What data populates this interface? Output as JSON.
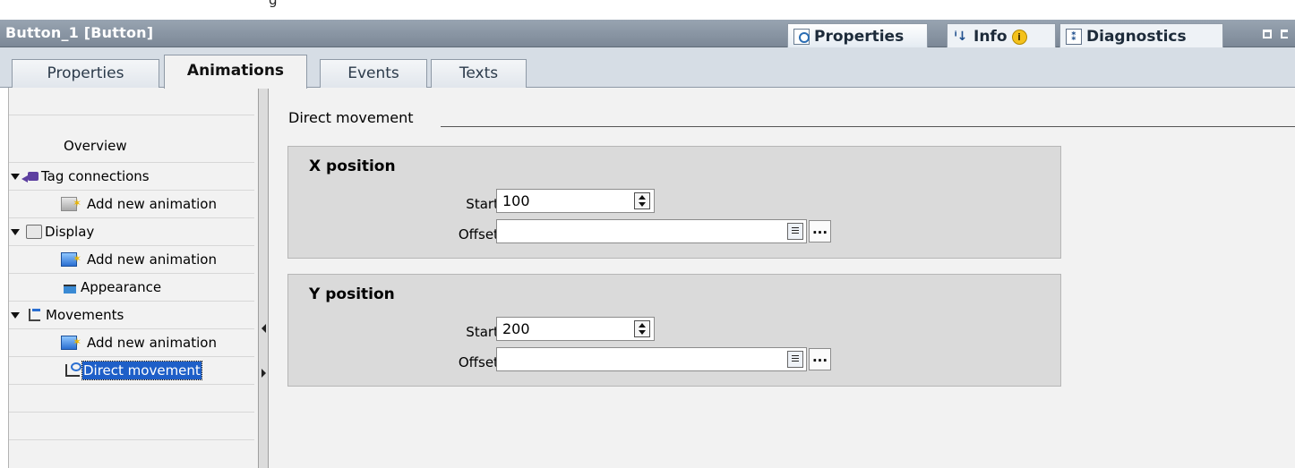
{
  "top_strip": {
    "fragment": "g"
  },
  "title_bar": {
    "title": "Button_1 [Button]",
    "inspector_tabs": {
      "properties": "Properties",
      "info": "Info",
      "info_badge": "i",
      "diagnostics": "Diagnostics"
    }
  },
  "sub_tabs": {
    "properties": "Properties",
    "animations": "Animations",
    "events": "Events",
    "texts": "Texts",
    "active": "Animations"
  },
  "nav": {
    "overview": "Overview",
    "tag_connections": "Tag connections",
    "tag_add": "Add new animation",
    "display": "Display",
    "display_add": "Add new animation",
    "appearance": "Appearance",
    "movements": "Movements",
    "movements_add": "Add new animation",
    "direct_movement": "Direct movement"
  },
  "main": {
    "section_title": "Direct movement",
    "x_group": {
      "title": "X position",
      "start_label": "Start:",
      "start_value": "100",
      "offset_label": "Offset:",
      "offset_value": "",
      "dots_label": "..."
    },
    "y_group": {
      "title": "Y position",
      "start_label": "Start:",
      "start_value": "200",
      "offset_label": "Offset:",
      "offset_value": "",
      "dots_label": "..."
    }
  },
  "colors": {
    "title_bar": "#8a96a4",
    "selection": "#1e5fc8",
    "panel_bg": "#f2f2f2",
    "group_bg": "#dadada"
  }
}
